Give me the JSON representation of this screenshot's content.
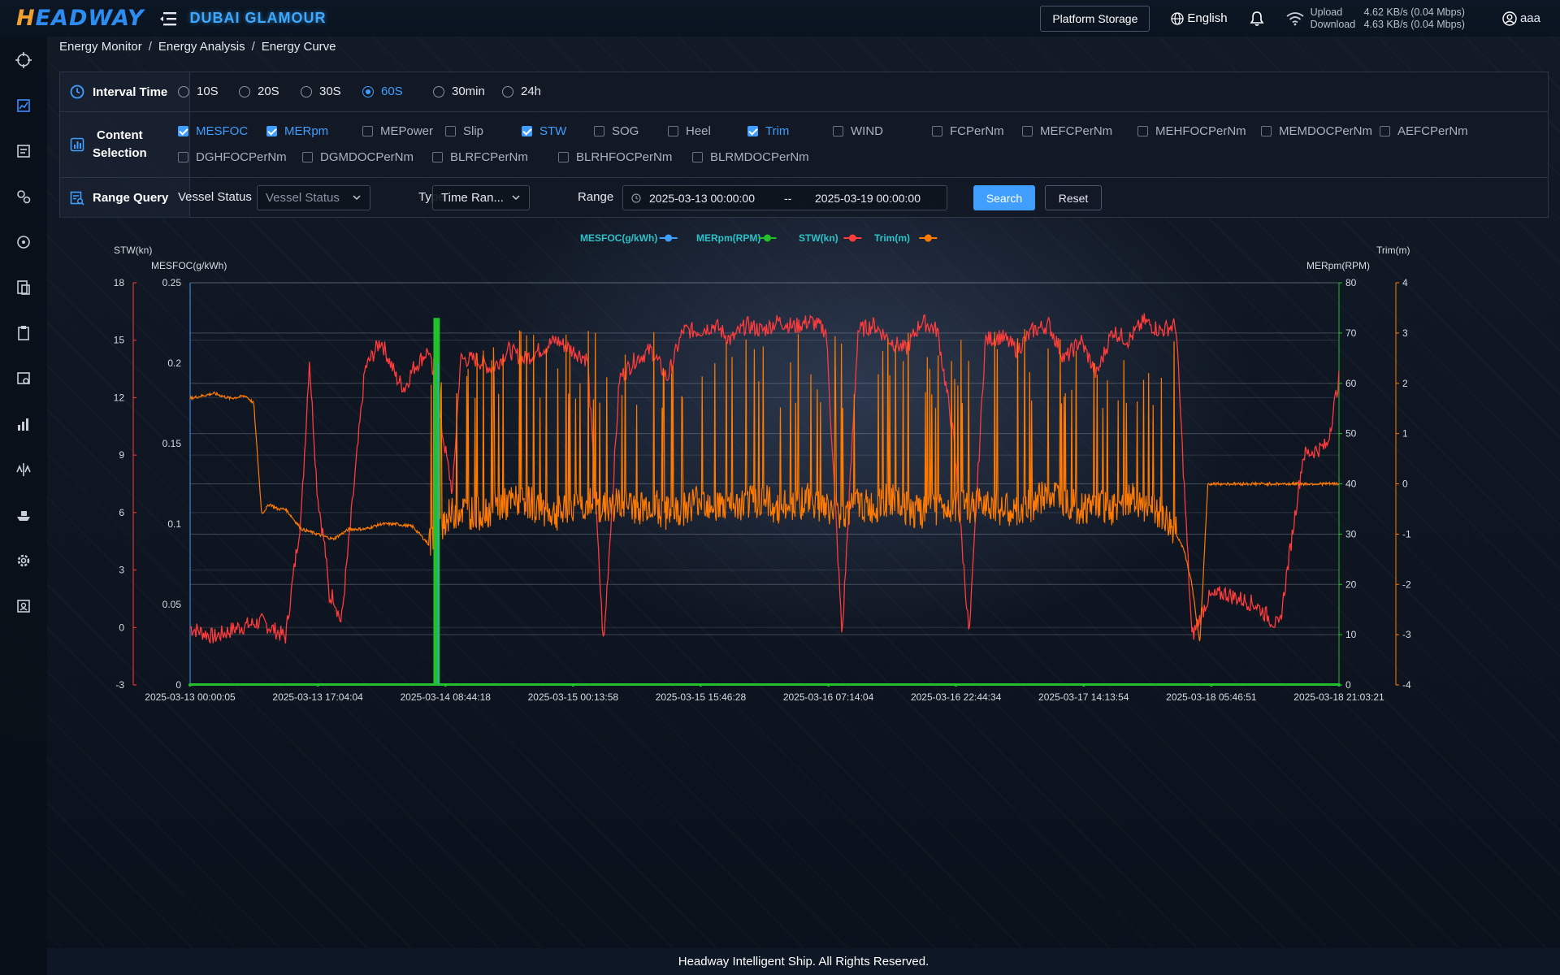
{
  "app": {
    "logo_text": "HEADWAY",
    "ship_name": "DUBAI GLAMOUR",
    "platform_storage": "Platform Storage",
    "language": "English",
    "upload_label": "Upload",
    "upload_value": "4.62 KB/s (0.04 Mbps)",
    "download_label": "Download",
    "download_value": "4.63 KB/s (0.04 Mbps)",
    "user": "aaa"
  },
  "sidebar": {
    "items": [
      "crosshair-icon",
      "chart-icon",
      "report-icon",
      "gears-icon",
      "target-icon",
      "document-icon",
      "clipboard-icon",
      "analysis-icon",
      "bar-chart-icon",
      "scale-icon",
      "ship-icon",
      "settings-icon",
      "user-card-icon"
    ]
  },
  "breadcrumb": [
    "Energy Monitor",
    "Energy Analysis",
    "Energy Curve"
  ],
  "filters": {
    "interval_label": "Interval Time",
    "intervals": [
      {
        "label": "10S",
        "selected": false
      },
      {
        "label": "20S",
        "selected": false
      },
      {
        "label": "30S",
        "selected": false
      },
      {
        "label": "60S",
        "selected": true
      },
      {
        "label": "30min",
        "selected": false
      },
      {
        "label": "24h",
        "selected": false
      }
    ],
    "content_label_1": "Content",
    "content_label_2": "Selection",
    "content_items": [
      {
        "label": "MESFOC",
        "checked": true
      },
      {
        "label": "MERpm",
        "checked": true
      },
      {
        "label": "MEPower",
        "checked": false
      },
      {
        "label": "Slip",
        "checked": false
      },
      {
        "label": "STW",
        "checked": true
      },
      {
        "label": "SOG",
        "checked": false
      },
      {
        "label": "Heel",
        "checked": false
      },
      {
        "label": "Trim",
        "checked": true
      },
      {
        "label": "WIND",
        "checked": false
      },
      {
        "label": "FCPerNm",
        "checked": false
      },
      {
        "label": "MEFCPerNm",
        "checked": false
      },
      {
        "label": "MEHFOCPerNm",
        "checked": false
      },
      {
        "label": "MEMDOCPerNm",
        "checked": false
      },
      {
        "label": "AEFCPerNm",
        "checked": false
      },
      {
        "label": "DGHFOCPerNm",
        "checked": false
      },
      {
        "label": "DGMDOCPerNm",
        "checked": false
      },
      {
        "label": "BLRFCPerNm",
        "checked": false
      },
      {
        "label": "BLRHFOCPerNm",
        "checked": false
      },
      {
        "label": "BLRMDOCPerNm",
        "checked": false
      }
    ],
    "range_label": "Range Query",
    "vessel_status_label": "Vessel Status",
    "vessel_status_placeholder": "Vessel Status",
    "type_label": "Type",
    "type_value": "Time Ran...",
    "range_text_label": "Range",
    "range_start": "2025-03-13 00:00:00",
    "range_sep": "--",
    "range_end": "2025-03-19 00:00:00",
    "search": "Search",
    "reset": "Reset"
  },
  "chart_data": {
    "type": "line",
    "legend_position": "top-center",
    "series": [
      {
        "name": "MESFOC(g/kWh)",
        "axis": "MESFOC",
        "color": "#409eff",
        "values": "near-empty (no visible trace)"
      },
      {
        "name": "MERpm(RPM)",
        "axis": "MERpm",
        "color": "#22c02c",
        "spike": {
          "from": "2025-03-14 06:40",
          "to": "2025-03-14 07:10",
          "peak": 73
        }
      },
      {
        "name": "STW(kn)",
        "axis": "STW",
        "color": "#ff3b3b",
        "x_hours": [
          0,
          3,
          6,
          9,
          12,
          14,
          15,
          16,
          17,
          17.5,
          18,
          19,
          22,
          24,
          26,
          27,
          28,
          30,
          33,
          34,
          36,
          38,
          40,
          42,
          44,
          46,
          48,
          50,
          52,
          54,
          56,
          58,
          60,
          62,
          64,
          66,
          68,
          70,
          72,
          74,
          76,
          78,
          80,
          82,
          84,
          86,
          88,
          90,
          92,
          94,
          96,
          98,
          100,
          102,
          104,
          106,
          108,
          110,
          112,
          114,
          116,
          118,
          120,
          122,
          124,
          126,
          128,
          130,
          132,
          134,
          137,
          140,
          143,
          144.5
        ],
        "values": [
          0,
          -0.5,
          0,
          0.3,
          -0.5,
          6,
          14,
          7,
          4,
          1.5,
          1.7,
          0.2,
          13.5,
          15,
          13,
          12.5,
          13.5,
          14.5,
          7,
          14,
          14,
          13.5,
          14.5,
          14,
          14.5,
          15,
          14.5,
          14,
          -1,
          13,
          14,
          14.5,
          13,
          15.5,
          15.5,
          15.8,
          15,
          15.8,
          15.5,
          16,
          15.7,
          16,
          15.5,
          -0.5,
          15.5,
          15.8,
          15,
          14.5,
          16,
          15.5,
          10,
          -0.5,
          15,
          15.2,
          14.5,
          15.5,
          15.8,
          14,
          15,
          13.2,
          15.5,
          15,
          16,
          15.5,
          15.8,
          -0.5,
          1.5,
          1.8,
          1.5,
          1.2,
          0,
          9,
          9.5,
          13
        ]
      },
      {
        "name": "Trim(m)",
        "axis": "Trim",
        "color": "#ff7a00",
        "x_hours": [
          0,
          3,
          5,
          7,
          8,
          9,
          10,
          11,
          12,
          14,
          16,
          18,
          20,
          22,
          24,
          26,
          28,
          30,
          32,
          34,
          36,
          38,
          40,
          42,
          44,
          46,
          48,
          50,
          52,
          54,
          56,
          58,
          60,
          62,
          64,
          66,
          68,
          70,
          72,
          74,
          76,
          78,
          80,
          82,
          84,
          86,
          88,
          90,
          92,
          94,
          96,
          98,
          100,
          102,
          104,
          106,
          108,
          110,
          112,
          114,
          116,
          118,
          120,
          122,
          124,
          125,
          126,
          127,
          128,
          130,
          134,
          138,
          142,
          144.5
        ],
        "values": [
          1.7,
          1.8,
          1.7,
          1.75,
          1.6,
          -0.6,
          -0.4,
          -0.5,
          -0.5,
          -0.9,
          -1.0,
          -1.1,
          -0.9,
          -0.9,
          -0.8,
          -0.8,
          -0.85,
          -1.2,
          -0.7,
          -0.5,
          -0.6,
          -0.5,
          -0.4,
          -0.3,
          -0.5,
          -0.6,
          -0.5,
          -0.4,
          -0.5,
          -0.4,
          -0.5,
          -0.4,
          -0.6,
          -0.5,
          -0.3,
          -0.4,
          -0.5,
          -0.4,
          -0.3,
          -0.5,
          -0.4,
          -0.3,
          -0.5,
          -0.6,
          -0.4,
          -0.5,
          -0.3,
          -0.5,
          -0.6,
          -0.5,
          -0.4,
          -0.5,
          -0.3,
          -0.5,
          -0.6,
          -0.4,
          -0.2,
          -0.3,
          -0.5,
          -0.4,
          -0.5,
          -0.3,
          -0.4,
          -0.6,
          -1.0,
          -1.3,
          -2.0,
          -3.2,
          0,
          0,
          0,
          0,
          0,
          0
        ]
      }
    ],
    "x_labels": [
      "2025-03-13 00:00:05",
      "2025-03-13 17:04:04",
      "2025-03-14 08:44:18",
      "2025-03-15 00:13:58",
      "2025-03-15 15:46:28",
      "2025-03-16 07:14:04",
      "2025-03-16 22:44:34",
      "2025-03-17 14:13:54",
      "2025-03-18 05:46:51",
      "2025-03-18 21:03:21"
    ],
    "axes": {
      "STW": {
        "label": "STW(kn)",
        "range": [
          -3,
          18
        ],
        "ticks": [
          "18",
          "15",
          "12",
          "9",
          "6",
          "3",
          "0",
          "-3"
        ]
      },
      "MESFOC": {
        "label": "MESFOC(g/kWh)",
        "range": [
          0,
          0.25
        ],
        "ticks": [
          "0.25",
          "0.2",
          "0.15",
          "0.1",
          "0.05",
          "0"
        ]
      },
      "MERpm": {
        "label": "MERpm(RPM)",
        "range": [
          0,
          80
        ],
        "ticks": [
          "80",
          "70",
          "60",
          "50",
          "40",
          "30",
          "20",
          "10",
          "0"
        ]
      },
      "Trim": {
        "label": "Trim(m)",
        "range": [
          -4,
          4
        ],
        "ticks": [
          "4",
          "3",
          "2",
          "1",
          "0",
          "-1",
          "-2",
          "-3",
          "-4"
        ]
      }
    },
    "grid": true
  },
  "footer": "Headway Intelligent Ship. All Rights Reserved."
}
